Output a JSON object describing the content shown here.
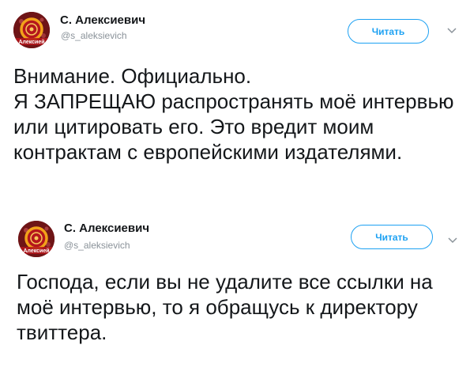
{
  "colors": {
    "accent": "#1da1f2",
    "text": "#14171a",
    "muted": "#8a9299",
    "avatar_bg": "#6e1416",
    "avatar_ring": "#f2a21a"
  },
  "icons": {
    "avatar": "avatar-icon",
    "chevron": "chevron-down-icon"
  },
  "tweets": [
    {
      "author_name": "С. Алексиевич",
      "handle": "@s_aleksievich",
      "follow_label": "Читать",
      "avatar_text": "Алексией",
      "text": "Внимание. Официально.\nЯ ЗАПРЕЩАЮ распространять моё интервью или цитировать его. Это вредит моим контрактам с европейскими издателями."
    },
    {
      "author_name": "С. Алексиевич",
      "handle": "@s_aleksievich",
      "follow_label": "Читать",
      "avatar_text": "Алексией",
      "text": "Господа, если вы не удалите все ссылки на моё интервью, то я обращусь к директору твиттера."
    }
  ]
}
